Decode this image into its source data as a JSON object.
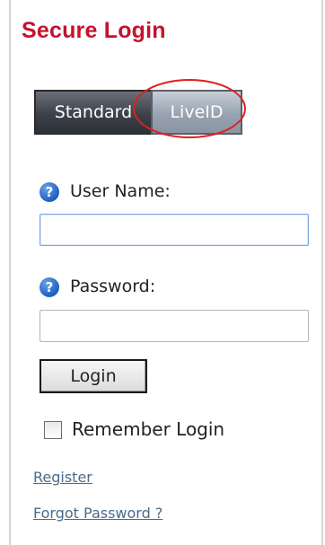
{
  "header": {
    "title": "Secure Login"
  },
  "tabs": [
    {
      "label": "Standard",
      "active": true
    },
    {
      "label": "LiveID",
      "active": false
    }
  ],
  "form": {
    "username": {
      "label": "User Name:",
      "value": "",
      "placeholder": "",
      "help_icon": "question-circle-icon"
    },
    "password": {
      "label": "Password:",
      "value": "",
      "placeholder": "",
      "help_icon": "question-circle-icon"
    },
    "login_label": "Login",
    "remember_label": "Remember Login",
    "remember_checked": false
  },
  "links": {
    "register": "Register",
    "forgot_password": "Forgot Password ?"
  },
  "colors": {
    "title": "#c8102e",
    "highlight": "#e02020",
    "link": "#4a6b8a",
    "help_icon": "#1f5fbf"
  }
}
